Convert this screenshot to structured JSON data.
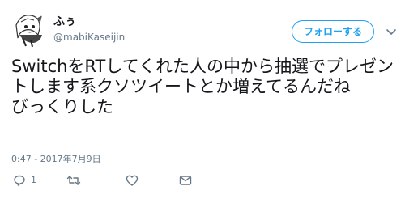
{
  "user": {
    "display_name": "ふぅ",
    "handle": "@mabiKaseijin"
  },
  "follow_button": {
    "label": "フォローする"
  },
  "tweet": {
    "text": "SwitchをRTしてくれた人の中から抽選でプレゼントします系クソツイートとか増えてるんだね\nびっくりした",
    "timestamp": "0:47 - 2017年7月9日"
  },
  "actions": {
    "reply_count": "1"
  },
  "colors": {
    "accent": "#1da1f2",
    "text": "#14171a",
    "muted": "#657786"
  },
  "icons": [
    "avatar-illustration",
    "chevron-down-icon",
    "reply-icon",
    "retweet-icon",
    "like-icon",
    "direct-message-icon"
  ]
}
